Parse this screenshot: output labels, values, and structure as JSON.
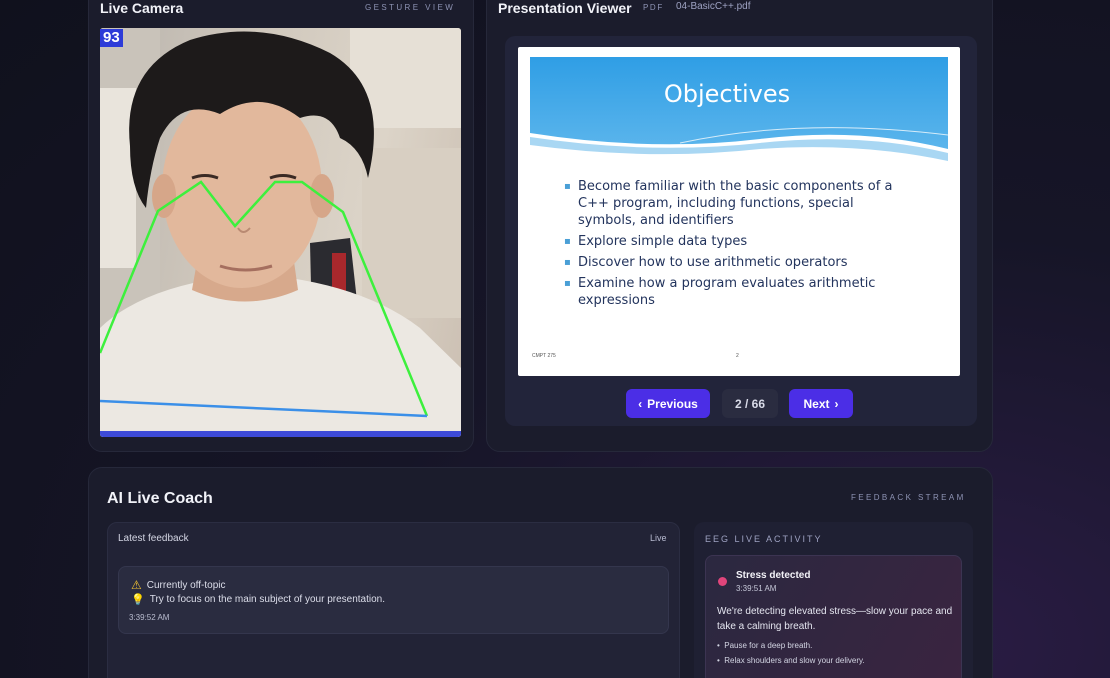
{
  "camera": {
    "title": "Live Camera",
    "tag": "GESTURE VIEW",
    "fps_badge": "93"
  },
  "viewer": {
    "title": "Presentation Viewer",
    "file_type": "PDF",
    "file_name": "04-BasicC++.pdf",
    "slide": {
      "title": "Objectives",
      "bullets": [
        "Become familiar with the basic components of a C++ program, including functions, special symbols, and identifiers",
        "Explore simple data types",
        "Discover how to use arithmetic operators",
        "Examine how a program evaluates arithmetic expressions"
      ],
      "footer_left": "CMPT 275",
      "footer_page": "2"
    },
    "nav": {
      "prev_label": "Previous",
      "page_indicator": "2 / 66",
      "next_label": "Next"
    }
  },
  "coach": {
    "title": "AI Live Coach",
    "tag": "FEEDBACK STREAM",
    "feedback": {
      "header": "Latest feedback",
      "status": "Live",
      "alert_title": "Currently off-topic",
      "alert_hint": "Try to focus on the main subject of your presentation.",
      "timestamp": "3:39:52 AM"
    },
    "eeg": {
      "header": "EEG LIVE ACTIVITY",
      "title": "Stress detected",
      "timestamp": "3:39:51 AM",
      "message": "We're detecting elevated stress—slow your pace and take a calming breath.",
      "tips": [
        "Pause for a deep breath.",
        "Relax shoulders and slow your delivery."
      ],
      "dot_color": "#e0457b"
    }
  },
  "colors": {
    "accent": "#4b2ee6",
    "overlay_line": "#3df03d",
    "overlay_base": "#3b8fe8"
  }
}
